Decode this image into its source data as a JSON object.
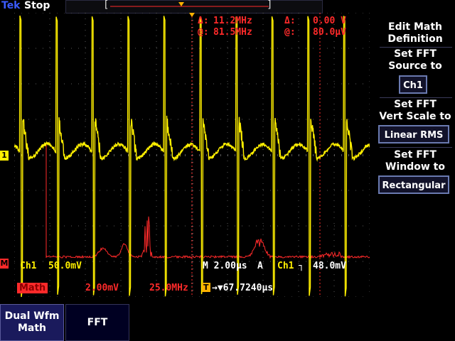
{
  "status": {
    "brand": "Tek",
    "run_state": "Stop"
  },
  "record_bar": {
    "left_bracket": "[",
    "right_bracket": "]"
  },
  "cursor_readout": {
    "delta_label": "Δ:",
    "delta_freq": "11.2MHz",
    "delta2_label": "Δ:",
    "delta_volt": "0.00 V",
    "at_label": "@:",
    "at_freq": "81.5MHz",
    "at2_label": "@:",
    "at_volt": "80.0μV"
  },
  "channel_status": {
    "ch1": "Ch1",
    "ch1_scale": "50.0mV",
    "timebase": "M 2.00μs",
    "trig_mode": "A",
    "trig_src": "Ch1",
    "trig_slope": "┐",
    "trig_level": "48.0mV"
  },
  "math_status": {
    "badge": "Math",
    "scale": "2.00mV",
    "freq_div": "25.0MHz",
    "trig_badge": "T",
    "trig_pos": "→▼67.7240μs"
  },
  "markers": {
    "ch1": "1",
    "math": "M"
  },
  "side_menu": {
    "title": [
      "Edit Math",
      "Definition"
    ],
    "fft_source_label": [
      "Set FFT",
      "Source to"
    ],
    "fft_source_value": "Ch1",
    "vert_scale_label": [
      "Set FFT",
      "Vert Scale to"
    ],
    "vert_scale_value": "Linear RMS",
    "window_label": [
      "Set FFT",
      "Window to"
    ],
    "window_value": "Rectangular"
  },
  "bottom_menu": {
    "dual_wfm_label": [
      "Dual Wfm",
      "Math"
    ],
    "fft_label": "FFT"
  },
  "colors": {
    "ch1": "#ffef00",
    "math": "#ff2a2a",
    "grid": "#5a5a5a",
    "accent": "#3b5bff"
  }
}
